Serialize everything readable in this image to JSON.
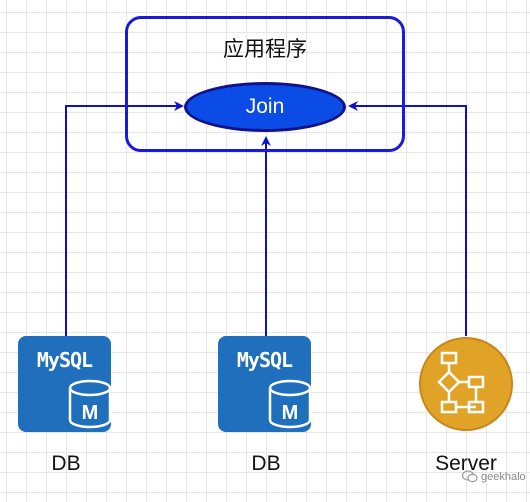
{
  "app": {
    "title": "应用程序"
  },
  "join": {
    "label": "Join"
  },
  "nodes": [
    {
      "icon_text": "MySQL",
      "badge": "M",
      "label": "DB"
    },
    {
      "icon_text": "MySQL",
      "badge": "M",
      "label": "DB"
    },
    {
      "label": "Server"
    }
  ],
  "watermark": {
    "text": "geekhalo"
  },
  "colors": {
    "frame": "#1a1adb",
    "join_fill": "#0b4be6",
    "connector": "#1010c8",
    "mysql_blue": "#1f6fbd",
    "server_gold": "#e0a327"
  }
}
